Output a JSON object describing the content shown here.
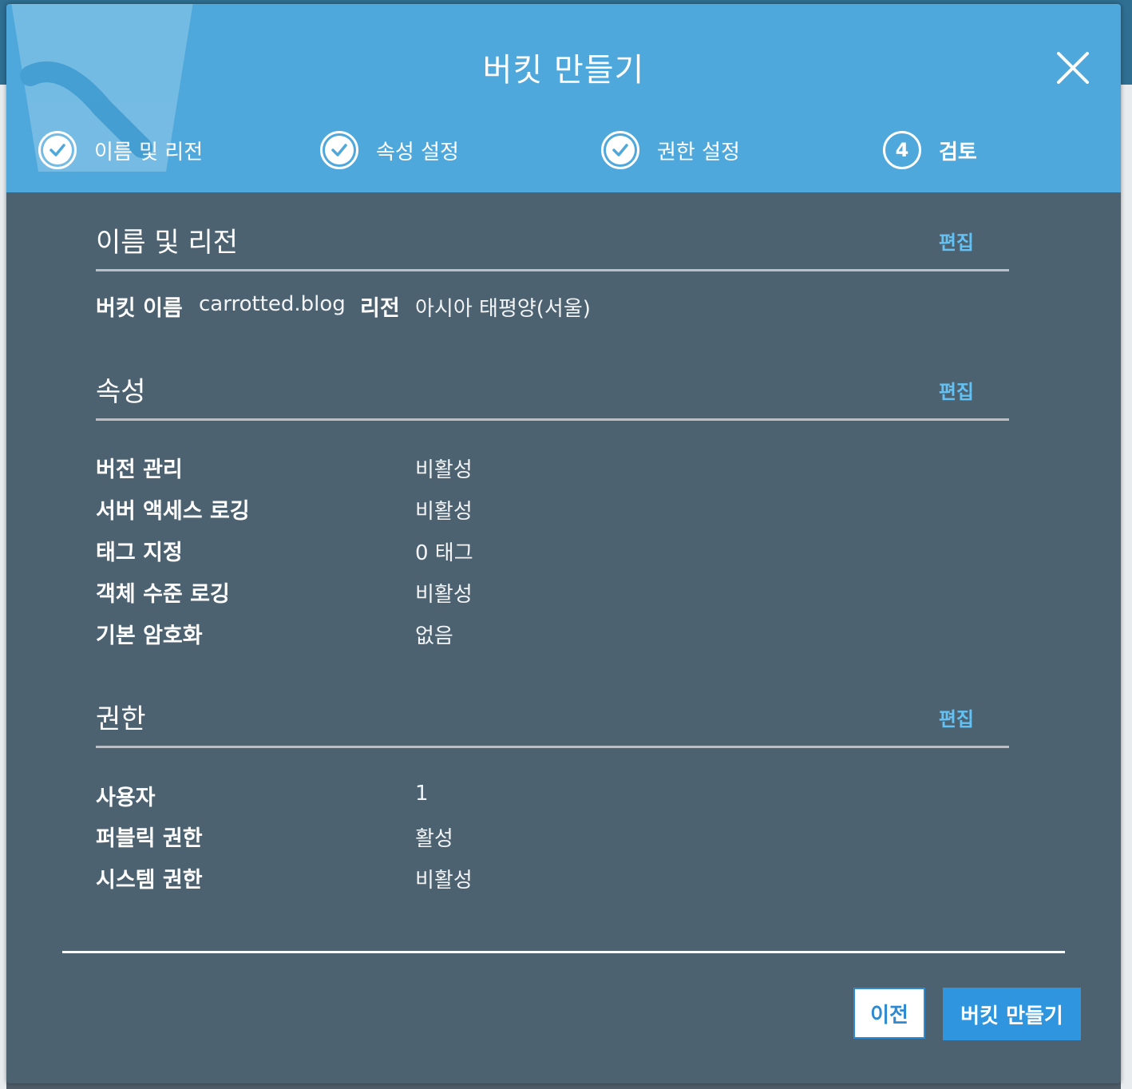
{
  "modal": {
    "title": "버킷 만들기",
    "close_icon": "close-icon"
  },
  "steps": [
    {
      "label": "이름 및 리전",
      "state": "done"
    },
    {
      "label": "속성 설정",
      "state": "done"
    },
    {
      "label": "권한 설정",
      "state": "done"
    },
    {
      "label": "검토",
      "state": "current",
      "number": "4"
    }
  ],
  "sections": {
    "name_region": {
      "title": "이름 및 리전",
      "edit": "편집",
      "bucket_name_label": "버킷 이름",
      "bucket_name_value": "carrotted.blog",
      "region_label": "리전",
      "region_value": "아시아 태평양(서울)"
    },
    "properties": {
      "title": "속성",
      "edit": "편집",
      "rows": [
        {
          "label": "버전 관리",
          "value": "비활성"
        },
        {
          "label": "서버 액세스 로깅",
          "value": "비활성"
        },
        {
          "label": "태그 지정",
          "value": "0 태그"
        },
        {
          "label": "객체 수준 로깅",
          "value": "비활성"
        },
        {
          "label": "기본 암호화",
          "value": "없음"
        }
      ]
    },
    "permissions": {
      "title": "권한",
      "edit": "편집",
      "rows": [
        {
          "label": "사용자",
          "value": "1"
        },
        {
          "label": "퍼블릭 권한",
          "value": "활성"
        },
        {
          "label": "시스템 권한",
          "value": "비활성"
        }
      ]
    }
  },
  "footer": {
    "prev_label": "이전",
    "create_label": "버킷 만들기"
  },
  "colors": {
    "header_bg": "#4ea8dc",
    "body_bg": "#4d6271",
    "link": "#63c1f3",
    "primary_button": "#2f95de"
  }
}
